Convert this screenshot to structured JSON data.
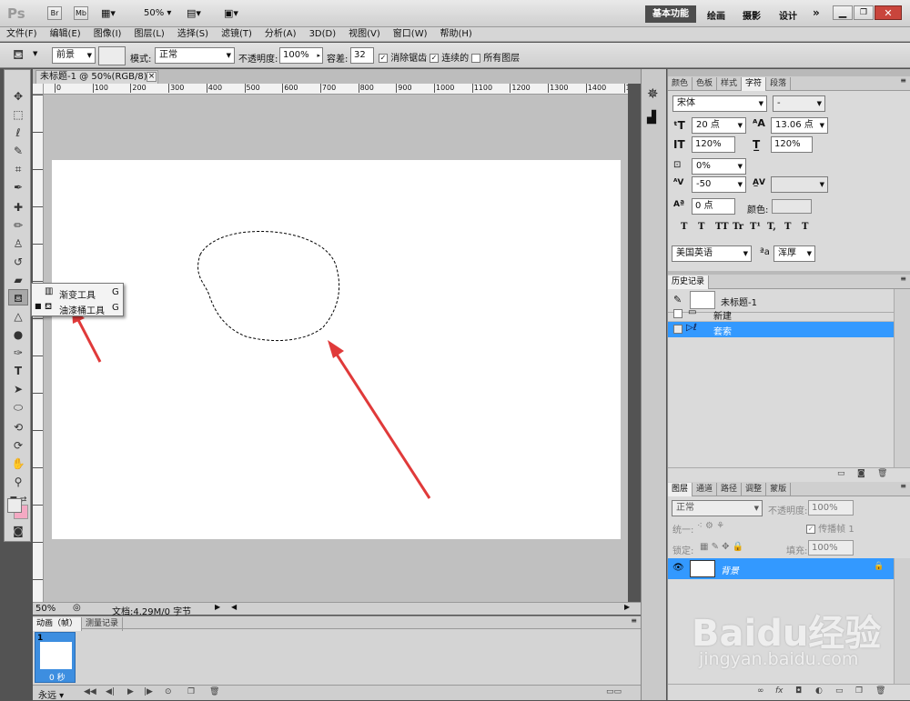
{
  "app": {
    "logo": "Ps",
    "btn_br": "Br",
    "btn_mb": "Mb",
    "zoom": "50%"
  },
  "workspace": {
    "essentials": "基本功能",
    "paint": "绘画",
    "photo": "摄影",
    "design": "设计",
    "more": "»"
  },
  "menu": [
    "文件(F)",
    "编辑(E)",
    "图像(I)",
    "图层(L)",
    "选择(S)",
    "滤镜(T)",
    "分析(A)",
    "3D(D)",
    "视图(V)",
    "窗口(W)",
    "帮助(H)"
  ],
  "options": {
    "fill_source": "前景",
    "mode_label": "模式:",
    "mode_value": "正常",
    "opacity_label": "不透明度:",
    "opacity_value": "100%",
    "tolerance_label": "容差:",
    "tolerance_value": "32",
    "antialias_label": "消除锯齿",
    "contiguous_label": "连续的",
    "all_layers_label": "所有图层",
    "antialias_checked": true,
    "contiguous_checked": true,
    "all_layers_checked": false
  },
  "doc": {
    "tab_title": "未标题-1 @ 50%(RGB/8)",
    "close": "×",
    "zoom": "50%",
    "status": "文档:4.29M/0 字节"
  },
  "ruler": {
    "h_ticks": [
      "0",
      "100",
      "200",
      "300",
      "400",
      "500",
      "600",
      "700",
      "800",
      "900",
      "1000",
      "1100",
      "1200",
      "1300",
      "1400",
      "15"
    ]
  },
  "flyout": [
    {
      "label": "渐变工具",
      "key": "G",
      "active": false
    },
    {
      "label": "油漆桶工具",
      "key": "G",
      "active": true
    }
  ],
  "char_panel": {
    "tabs": [
      "颜色",
      "色板",
      "样式",
      "字符",
      "段落"
    ],
    "active_tab": "字符",
    "font_family": "宋体",
    "font_style": "-",
    "font_size": "20 点",
    "leading": "13.06 点",
    "vscale": "120%",
    "hscale": "120%",
    "baseline_shift_pct": "0%",
    "tracking": "-50",
    "kerning": "",
    "baseline": "0 点",
    "color_label": "颜色:",
    "styles": [
      "T",
      "T",
      "TT",
      "Tr",
      "T¹",
      "T,",
      "T",
      "T"
    ],
    "language": "美国英语",
    "aa_label": "ªa",
    "antialias": "浑厚"
  },
  "history": {
    "tab": "历史记录",
    "snapshot": "未标题-1",
    "items": [
      {
        "label": "新建",
        "selected": false
      },
      {
        "label": "套索",
        "selected": true
      }
    ]
  },
  "layers": {
    "tabs": [
      "图层",
      "通道",
      "路径",
      "调整",
      "蒙版"
    ],
    "active_tab": "图层",
    "blend": "正常",
    "opacity_label": "不透明度:",
    "opacity": "100%",
    "unify_label": "统一:",
    "propagate_label": "传播帧 1",
    "lock_label": "锁定:",
    "fill_label": "填充:",
    "fill": "100%",
    "layer_name": "背景"
  },
  "animation": {
    "tab_anim": "动画（帧）",
    "tab_measure": "测量记录",
    "frame_num": "1",
    "frame_delay": "0 秒",
    "loop": "永远"
  },
  "watermark": {
    "brand": "Baidu经验",
    "url": "jingyan.baidu.com"
  },
  "colors": {
    "selection": "#3399ff",
    "canvas_bg": "#c0c0c0",
    "arrow": "#e03a3a"
  }
}
